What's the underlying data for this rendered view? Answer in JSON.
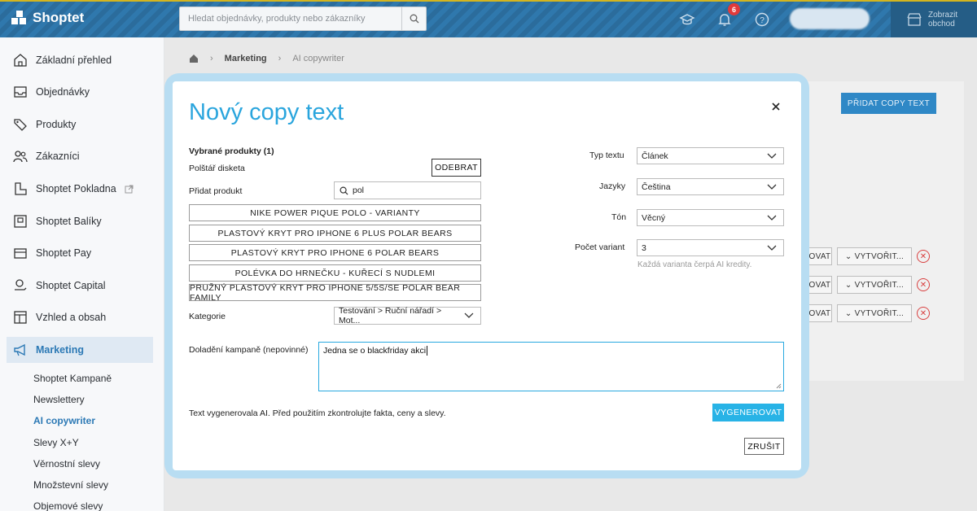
{
  "header": {
    "logo_text": "Shoptet",
    "search_placeholder": "Hledat objednávky, produkty nebo zákazníky",
    "notification_count": "6",
    "show_shop_line1": "Zobrazit",
    "show_shop_line2": "obchod"
  },
  "sidebar": {
    "items": [
      {
        "label": "Základní přehled",
        "icon": "home-icon"
      },
      {
        "label": "Objednávky",
        "icon": "inbox-icon"
      },
      {
        "label": "Produkty",
        "icon": "tag-icon"
      },
      {
        "label": "Zákazníci",
        "icon": "users-icon"
      },
      {
        "label": "Shoptet Pokladna",
        "icon": "register-icon"
      },
      {
        "label": "Shoptet Balíky",
        "icon": "package-icon"
      },
      {
        "label": "Shoptet Pay",
        "icon": "wallet-icon"
      },
      {
        "label": "Shoptet Capital",
        "icon": "money-icon"
      },
      {
        "label": "Vzhled a obsah",
        "icon": "layout-icon"
      },
      {
        "label": "Marketing",
        "icon": "megaphone-icon"
      }
    ],
    "subitems": [
      "Shoptet Kampaně",
      "Newslettery",
      "AI copywriter",
      "Slevy X+Y",
      "Věrnostní slevy",
      "Množstevní slevy",
      "Objemové slevy"
    ]
  },
  "breadcrumb": {
    "section": "Marketing",
    "page": "AI copywriter"
  },
  "background": {
    "add_button": "PŘIDAT COPY TEXT",
    "row_btn_left": "OVAT",
    "row_btn_right": "VYTVOŘIT..."
  },
  "modal": {
    "title": "Nový copy text",
    "selected_heading": "Vybrané produkty (1)",
    "selected_product": "Polštář disketa",
    "remove_button": "ODEBRAT",
    "add_product_label": "Přidat produkt",
    "add_product_value": "pol",
    "suggestions": [
      "NIKE POWER PIQUE POLO - VARIANTY",
      "PLASTOVÝ KRYT PRO IPHONE 6 PLUS POLAR BEARS",
      "PLASTOVÝ KRYT PRO IPHONE 6 POLAR BEARS",
      "POLÉVKA DO HRNEČKU - KUŘECÍ S NUDLEMI",
      "PRUŽNÝ PLASTOVÝ KRYT PRO IPHONE 5/5S/SE POLAR BEAR FAMILY"
    ],
    "category_label": "Kategorie",
    "category_value": "Testování > Ruční nářadí > Mot...",
    "text_type_label": "Typ textu",
    "text_type_value": "Článek",
    "languages_label": "Jazyky",
    "languages_value": "Čeština",
    "tone_label": "Tón",
    "tone_value": "Věcný",
    "variants_label": "Počet variant",
    "variants_value": "3",
    "variants_hint": "Každá varianta čerpá AI kredity.",
    "campaign_label": "Doladění kampaně (nepovinné)",
    "campaign_value": "Jedna se o blackfriday akci",
    "disclaimer": "Text vygenerovala AI. Před použitím zkontrolujte fakta, ceny a slevy.",
    "generate_button": "VYGENEROVAT",
    "cancel_button": "ZRUŠIT"
  }
}
